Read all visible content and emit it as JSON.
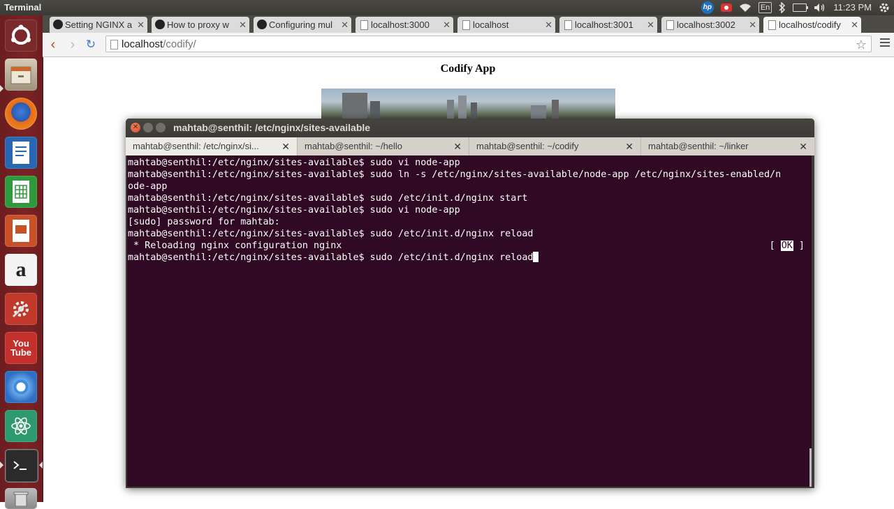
{
  "top_panel": {
    "app_title": "Terminal",
    "lang": "En",
    "time": "11:23 PM"
  },
  "launcher": {
    "items": [
      "Ubuntu Dash",
      "Files",
      "Firefox",
      "LibreOffice Writer",
      "LibreOffice Calc",
      "LibreOffice Impress",
      "Amazon",
      "System Settings",
      "YouTube",
      "Chromium",
      "Atom",
      "Terminal",
      "Trash"
    ],
    "youtube_top": "You",
    "youtube_bottom": "Tube"
  },
  "browser": {
    "tabs": [
      {
        "title": "Setting NGINX a",
        "icon": "github-icon"
      },
      {
        "title": "How to proxy w",
        "icon": "github-icon"
      },
      {
        "title": "Configuring mul",
        "icon": "github-icon"
      },
      {
        "title": "localhost:3000",
        "icon": "page-icon"
      },
      {
        "title": "localhost",
        "icon": "page-icon"
      },
      {
        "title": "localhost:3001",
        "icon": "page-icon"
      },
      {
        "title": "localhost:3002",
        "icon": "page-icon"
      },
      {
        "title": "localhost/codify",
        "icon": "page-icon"
      }
    ],
    "url_host": "localhost",
    "url_path": "/codify/",
    "page_heading": "Codify App"
  },
  "terminal": {
    "window_title": "mahtab@senthil: /etc/nginx/sites-available",
    "tabs": [
      {
        "title": "mahtab@senthil: /etc/nginx/si..."
      },
      {
        "title": "mahtab@senthil: ~/hello"
      },
      {
        "title": "mahtab@senthil: ~/codify"
      },
      {
        "title": "mahtab@senthil: ~/linker"
      }
    ],
    "lines": [
      "mahtab@senthil:/etc/nginx/sites-available$ sudo vi node-app",
      "mahtab@senthil:/etc/nginx/sites-available$ sudo ln -s /etc/nginx/sites-available/node-app /etc/nginx/sites-enabled/n",
      "ode-app",
      "mahtab@senthil:/etc/nginx/sites-available$ sudo /etc/init.d/nginx start",
      "mahtab@senthil:/etc/nginx/sites-available$ sudo vi node-app",
      "[sudo] password for mahtab:",
      "mahtab@senthil:/etc/nginx/sites-available$ sudo /etc/init.d/nginx reload",
      " * Reloading nginx configuration nginx",
      "mahtab@senthil:/etc/nginx/sites-available$ sudo /etc/init.d/nginx reload"
    ],
    "ok_status": {
      "left": "[ ",
      "ok": "OK",
      "right": " ]"
    }
  }
}
